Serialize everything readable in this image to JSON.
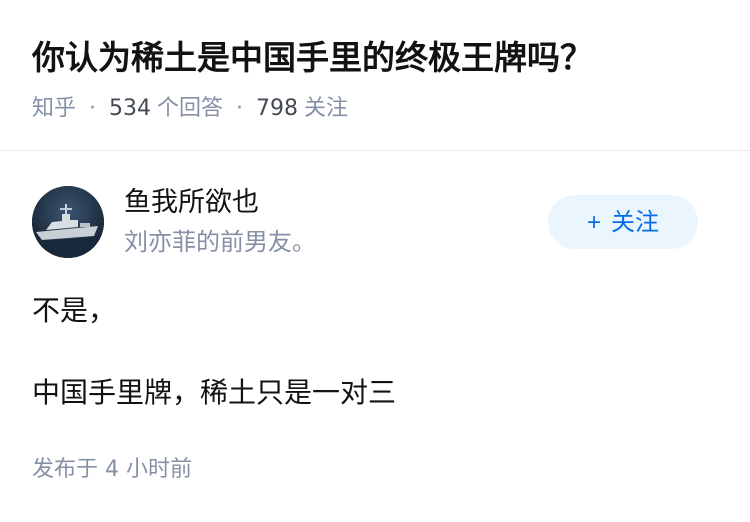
{
  "question": {
    "title": "你认为稀土是中国手里的终极王牌吗？",
    "source": "知乎",
    "answer_count": "534",
    "answer_label": "个回答",
    "follow_count": "798",
    "follow_label": "关注",
    "separator": "·"
  },
  "answer": {
    "author": {
      "name": "鱼我所欲也",
      "bio": "刘亦菲的前男友。",
      "avatar_icon": "warship-avatar"
    },
    "follow_button": {
      "icon": "plus-icon",
      "icon_glyph": "+",
      "label": "关注"
    },
    "paragraphs": [
      "不是，",
      "中国手里牌，稀土只是一对三"
    ],
    "published": "发布于  4 小时前"
  },
  "colors": {
    "primary_text": "#121212",
    "secondary_text": "#8590a6",
    "accent": "#056de8",
    "follow_bg": "#ebf5fd",
    "divider": "#ebebeb"
  }
}
